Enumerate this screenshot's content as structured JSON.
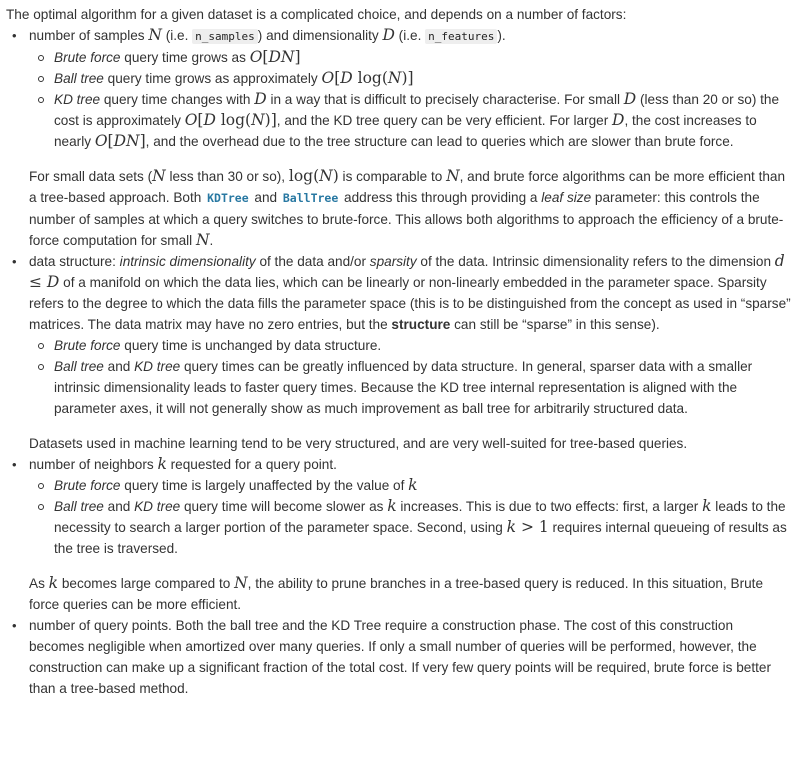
{
  "intro": "The optimal algorithm for a given dataset is a complicated choice, and depends on a number of factors:",
  "items": [
    {
      "segments": [
        {
          "t": "number of samples "
        },
        {
          "m": "N"
        },
        {
          "t": " (i.e. "
        },
        {
          "c": "n_samples"
        },
        {
          "t": ") and dimensionality "
        },
        {
          "m": "D"
        },
        {
          "t": " (i.e. "
        },
        {
          "c": "n_features"
        },
        {
          "t": ")."
        }
      ],
      "subitems": [
        [
          {
            "e": "Brute force"
          },
          {
            "t": " query time grows as "
          },
          {
            "m": "O"
          },
          {
            "u": "["
          },
          {
            "m": "DN"
          },
          {
            "u": "]"
          }
        ],
        [
          {
            "e": "Ball tree"
          },
          {
            "t": " query time grows as approximately "
          },
          {
            "m": "O"
          },
          {
            "u": "["
          },
          {
            "m": "D"
          },
          {
            "u": " log("
          },
          {
            "m": "N"
          },
          {
            "u": ")]"
          }
        ],
        [
          {
            "e": "KD tree"
          },
          {
            "t": " query time changes with "
          },
          {
            "m": "D"
          },
          {
            "t": " in a way that is difficult to precisely characterise. For small "
          },
          {
            "m": "D"
          },
          {
            "t": " (less than 20 or so) the cost is approximately "
          },
          {
            "m": "O"
          },
          {
            "u": "["
          },
          {
            "m": "D"
          },
          {
            "u": " log("
          },
          {
            "m": "N"
          },
          {
            "u": ")]"
          },
          {
            "t": ", and the KD tree query can be very efficient. For larger "
          },
          {
            "m": "D"
          },
          {
            "t": ", the cost increases to nearly "
          },
          {
            "m": "O"
          },
          {
            "u": "["
          },
          {
            "m": "DN"
          },
          {
            "u": "]"
          },
          {
            "t": ", and the overhead due to the tree structure can lead to queries which are slower than brute force."
          }
        ]
      ],
      "after": [
        {
          "t": "For small data sets ("
        },
        {
          "m": "N"
        },
        {
          "t": " less than 30 or so), "
        },
        {
          "u": "log("
        },
        {
          "m": "N"
        },
        {
          "u": ")"
        },
        {
          "t": " is comparable to "
        },
        {
          "m": "N"
        },
        {
          "t": ", and brute force algorithms can be more efficient than a tree-based approach. Both "
        },
        {
          "r": "KDTree"
        },
        {
          "t": " and "
        },
        {
          "r": "BallTree"
        },
        {
          "t": " address this through providing a "
        },
        {
          "e": "leaf size"
        },
        {
          "t": " parameter: this controls the number of samples at which a query switches to brute-force. This allows both algorithms to approach the efficiency of a brute-force computation for small "
        },
        {
          "m": "N"
        },
        {
          "t": "."
        }
      ]
    },
    {
      "segments": [
        {
          "t": "data structure: "
        },
        {
          "e": "intrinsic dimensionality"
        },
        {
          "t": " of the data and/or "
        },
        {
          "e": "sparsity"
        },
        {
          "t": " of the data. Intrinsic dimensionality refers to the dimension "
        },
        {
          "m": "d"
        },
        {
          "u": " ≤ "
        },
        {
          "m": "D"
        },
        {
          "t": " of a manifold on which the data lies, which can be linearly or non-linearly embedded in the parameter space. Sparsity refers to the degree to which the data fills the parameter space (this is to be distinguished from the concept as used in “sparse” matrices. The data matrix may have no zero entries, but the "
        },
        {
          "b": "structure"
        },
        {
          "t": " can still be “sparse” in this sense)."
        }
      ],
      "subitems": [
        [
          {
            "e": "Brute force"
          },
          {
            "t": " query time is unchanged by data structure."
          }
        ],
        [
          {
            "e": "Ball tree"
          },
          {
            "t": " and "
          },
          {
            "e": "KD tree"
          },
          {
            "t": " query times can be greatly influenced by data structure. In general, sparser data with a smaller intrinsic dimensionality leads to faster query times. Because the KD tree internal representation is aligned with the parameter axes, it will not generally show as much improvement as ball tree for arbitrarily structured data."
          }
        ]
      ],
      "after": [
        {
          "t": "Datasets used in machine learning tend to be very structured, and are very well-suited for tree-based queries."
        }
      ]
    },
    {
      "segments": [
        {
          "t": "number of neighbors "
        },
        {
          "m": "k"
        },
        {
          "t": " requested for a query point."
        }
      ],
      "subitems": [
        [
          {
            "e": "Brute force"
          },
          {
            "t": " query time is largely unaffected by the value of "
          },
          {
            "m": "k"
          }
        ],
        [
          {
            "e": "Ball tree"
          },
          {
            "t": " and "
          },
          {
            "e": "KD tree"
          },
          {
            "t": " query time will become slower as "
          },
          {
            "m": "k"
          },
          {
            "t": " increases. This is due to two effects: first, a larger "
          },
          {
            "m": "k"
          },
          {
            "t": " leads to the necessity to search a larger portion of the parameter space. Second, using "
          },
          {
            "m": "k"
          },
          {
            "u": " > 1"
          },
          {
            "t": " requires internal queueing of results as the tree is traversed."
          }
        ]
      ],
      "after": [
        {
          "t": "As "
        },
        {
          "m": "k"
        },
        {
          "t": " becomes large compared to "
        },
        {
          "m": "N"
        },
        {
          "t": ", the ability to prune branches in a tree-based query is reduced. In this situation, Brute force queries can be more efficient."
        }
      ]
    },
    {
      "segments": [
        {
          "t": "number of query points. Both the ball tree and the KD Tree require a construction phase. The cost of this construction becomes negligible when amortized over many queries. If only a small number of queries will be performed, however, the construction can make up a significant fraction of the total cost. If very few query points will be required, brute force is better than a tree-based method."
        }
      ],
      "subitems": [],
      "after": []
    }
  ]
}
